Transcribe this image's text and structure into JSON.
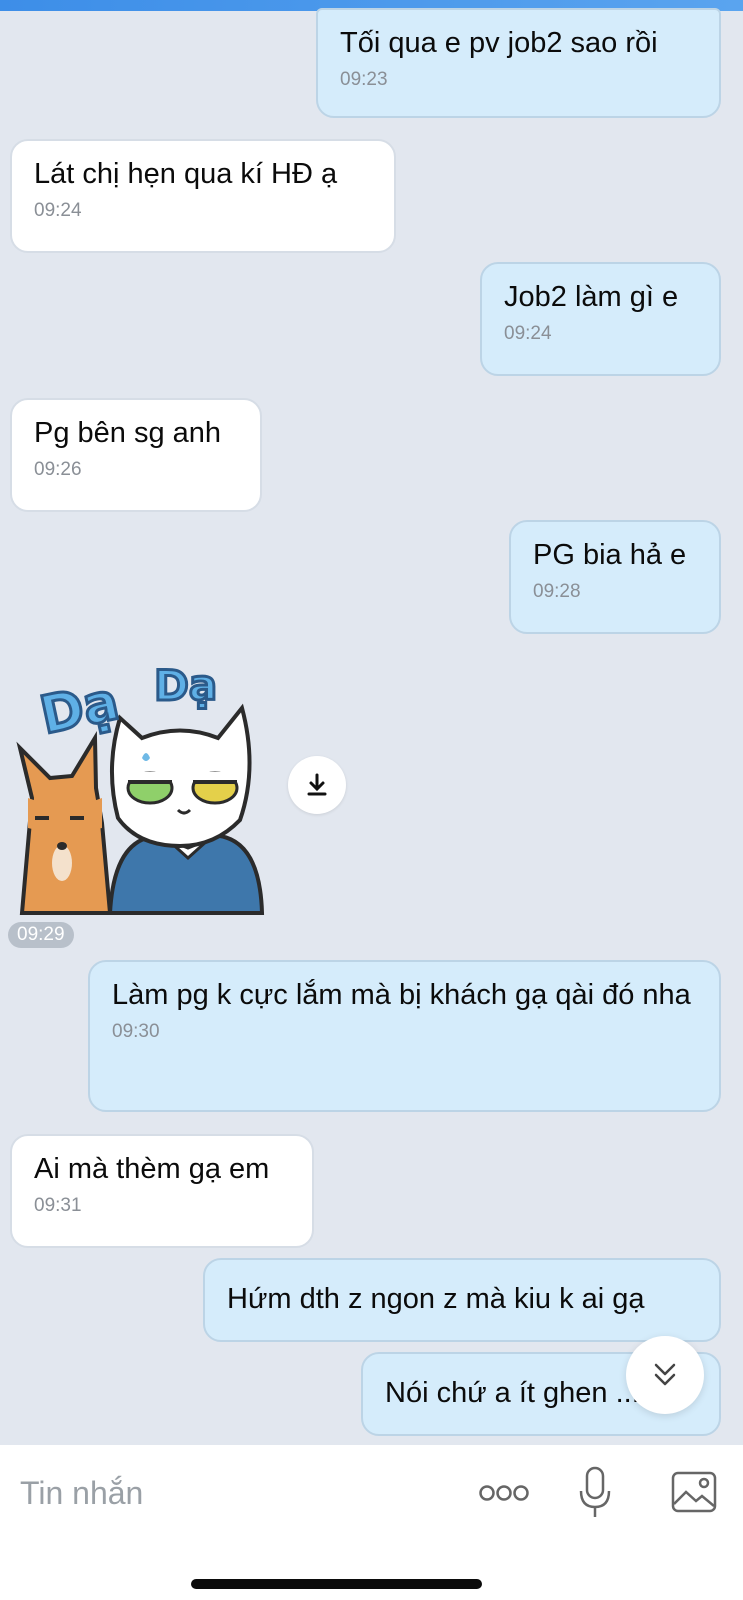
{
  "messages": [
    {
      "side": "out",
      "text": "Tối qua e pv job2 sao rồi",
      "time": "09:23"
    },
    {
      "side": "in",
      "text": "Lát chị hẹn qua kí HĐ ạ",
      "time": "09:24"
    },
    {
      "side": "out",
      "text": "Job2 làm gì e",
      "time": "09:24"
    },
    {
      "side": "in",
      "text": "Pg bên sg anh",
      "time": "09:26"
    },
    {
      "side": "out",
      "text": "PG bia hả e",
      "time": "09:28"
    },
    {
      "side": "out",
      "text": "Làm pg k cực lắm mà bị khách gạ qài đó nha",
      "time": "09:30"
    },
    {
      "side": "in",
      "text": "Ai mà thèm gạ em",
      "time": "09:31"
    },
    {
      "side": "out",
      "text": "Hứm dth z ngon z mà kiu k ai gạ",
      "time": ""
    },
    {
      "side": "out",
      "text": "Nói chứ a ít ghen ...",
      "time": ""
    }
  ],
  "sticker": {
    "text_left": "Dạ",
    "text_right": "Dạ",
    "time": "09:29"
  },
  "input": {
    "placeholder": "Tin nhắn"
  },
  "icons": {
    "download": "download-icon",
    "scroll_down": "double-chevron-down-icon",
    "more": "more-dots-icon",
    "mic": "microphone-icon",
    "image": "image-icon"
  },
  "colors": {
    "background": "#e2e7ef",
    "incoming_bubble": "#ffffff",
    "outgoing_bubble": "#d5ecfb",
    "accent": "#3d8ee8"
  }
}
